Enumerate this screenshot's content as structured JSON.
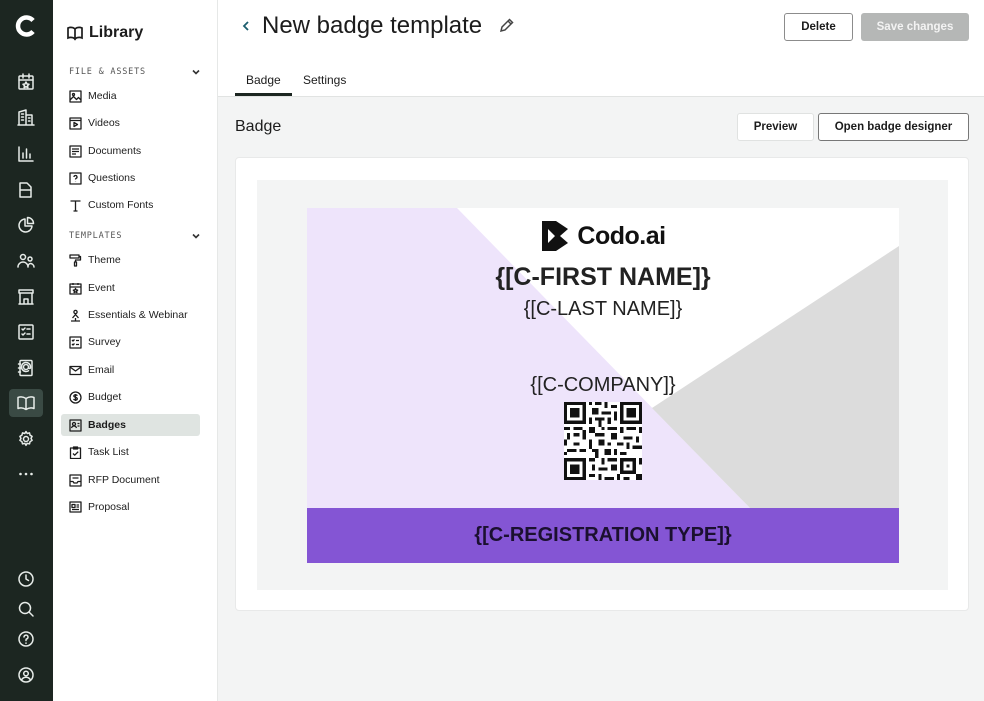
{
  "rail": {
    "items": [
      "calendar-star-icon",
      "building-icon",
      "bar-chart-icon",
      "folder-icon",
      "pie-chart-icon",
      "users-icon",
      "store-icon",
      "checklist-icon",
      "contact-book-icon",
      "library-icon",
      "gear-icon",
      "more-icon"
    ],
    "bottom": [
      "history-icon",
      "search-icon",
      "help-icon",
      "account-icon"
    ],
    "active": "library-icon"
  },
  "sidebar": {
    "title": "Library",
    "files_section": "FILE & ASSETS",
    "files": [
      {
        "label": "Media",
        "icon": "image-icon"
      },
      {
        "label": "Videos",
        "icon": "video-icon"
      },
      {
        "label": "Documents",
        "icon": "document-icon"
      },
      {
        "label": "Questions",
        "icon": "question-icon"
      },
      {
        "label": "Custom Fonts",
        "icon": "font-icon"
      }
    ],
    "templates_section": "TEMPLATES",
    "templates": [
      {
        "label": "Theme",
        "icon": "paint-roller-icon"
      },
      {
        "label": "Event",
        "icon": "calendar-star-icon"
      },
      {
        "label": "Essentials & Webinar",
        "icon": "presenter-icon"
      },
      {
        "label": "Survey",
        "icon": "survey-icon"
      },
      {
        "label": "Email",
        "icon": "mail-icon"
      },
      {
        "label": "Budget",
        "icon": "dollar-icon"
      },
      {
        "label": "Badges",
        "icon": "badge-icon"
      },
      {
        "label": "Task List",
        "icon": "task-icon"
      },
      {
        "label": "RFP Document",
        "icon": "inbox-icon"
      },
      {
        "label": "Proposal",
        "icon": "proposal-icon"
      }
    ],
    "active": "Badges"
  },
  "header": {
    "title": "New badge template",
    "delete_label": "Delete",
    "save_label": "Save changes",
    "tabs": [
      "Badge",
      "Settings"
    ],
    "active_tab": "Badge"
  },
  "content": {
    "title": "Badge",
    "preview_label": "Preview",
    "open_designer_label": "Open badge designer"
  },
  "badge": {
    "brand": "Codo.ai",
    "first_name": "{[C-FIRST NAME]}",
    "last_name": "{[C-LAST NAME]}",
    "company": "{[C-COMPANY]}",
    "registration_type": "{[C-REGISTRATION TYPE]}",
    "colors": {
      "lavender": "#eee4fb",
      "gray": "#dcdcdc",
      "purple": "#8455d4"
    }
  }
}
